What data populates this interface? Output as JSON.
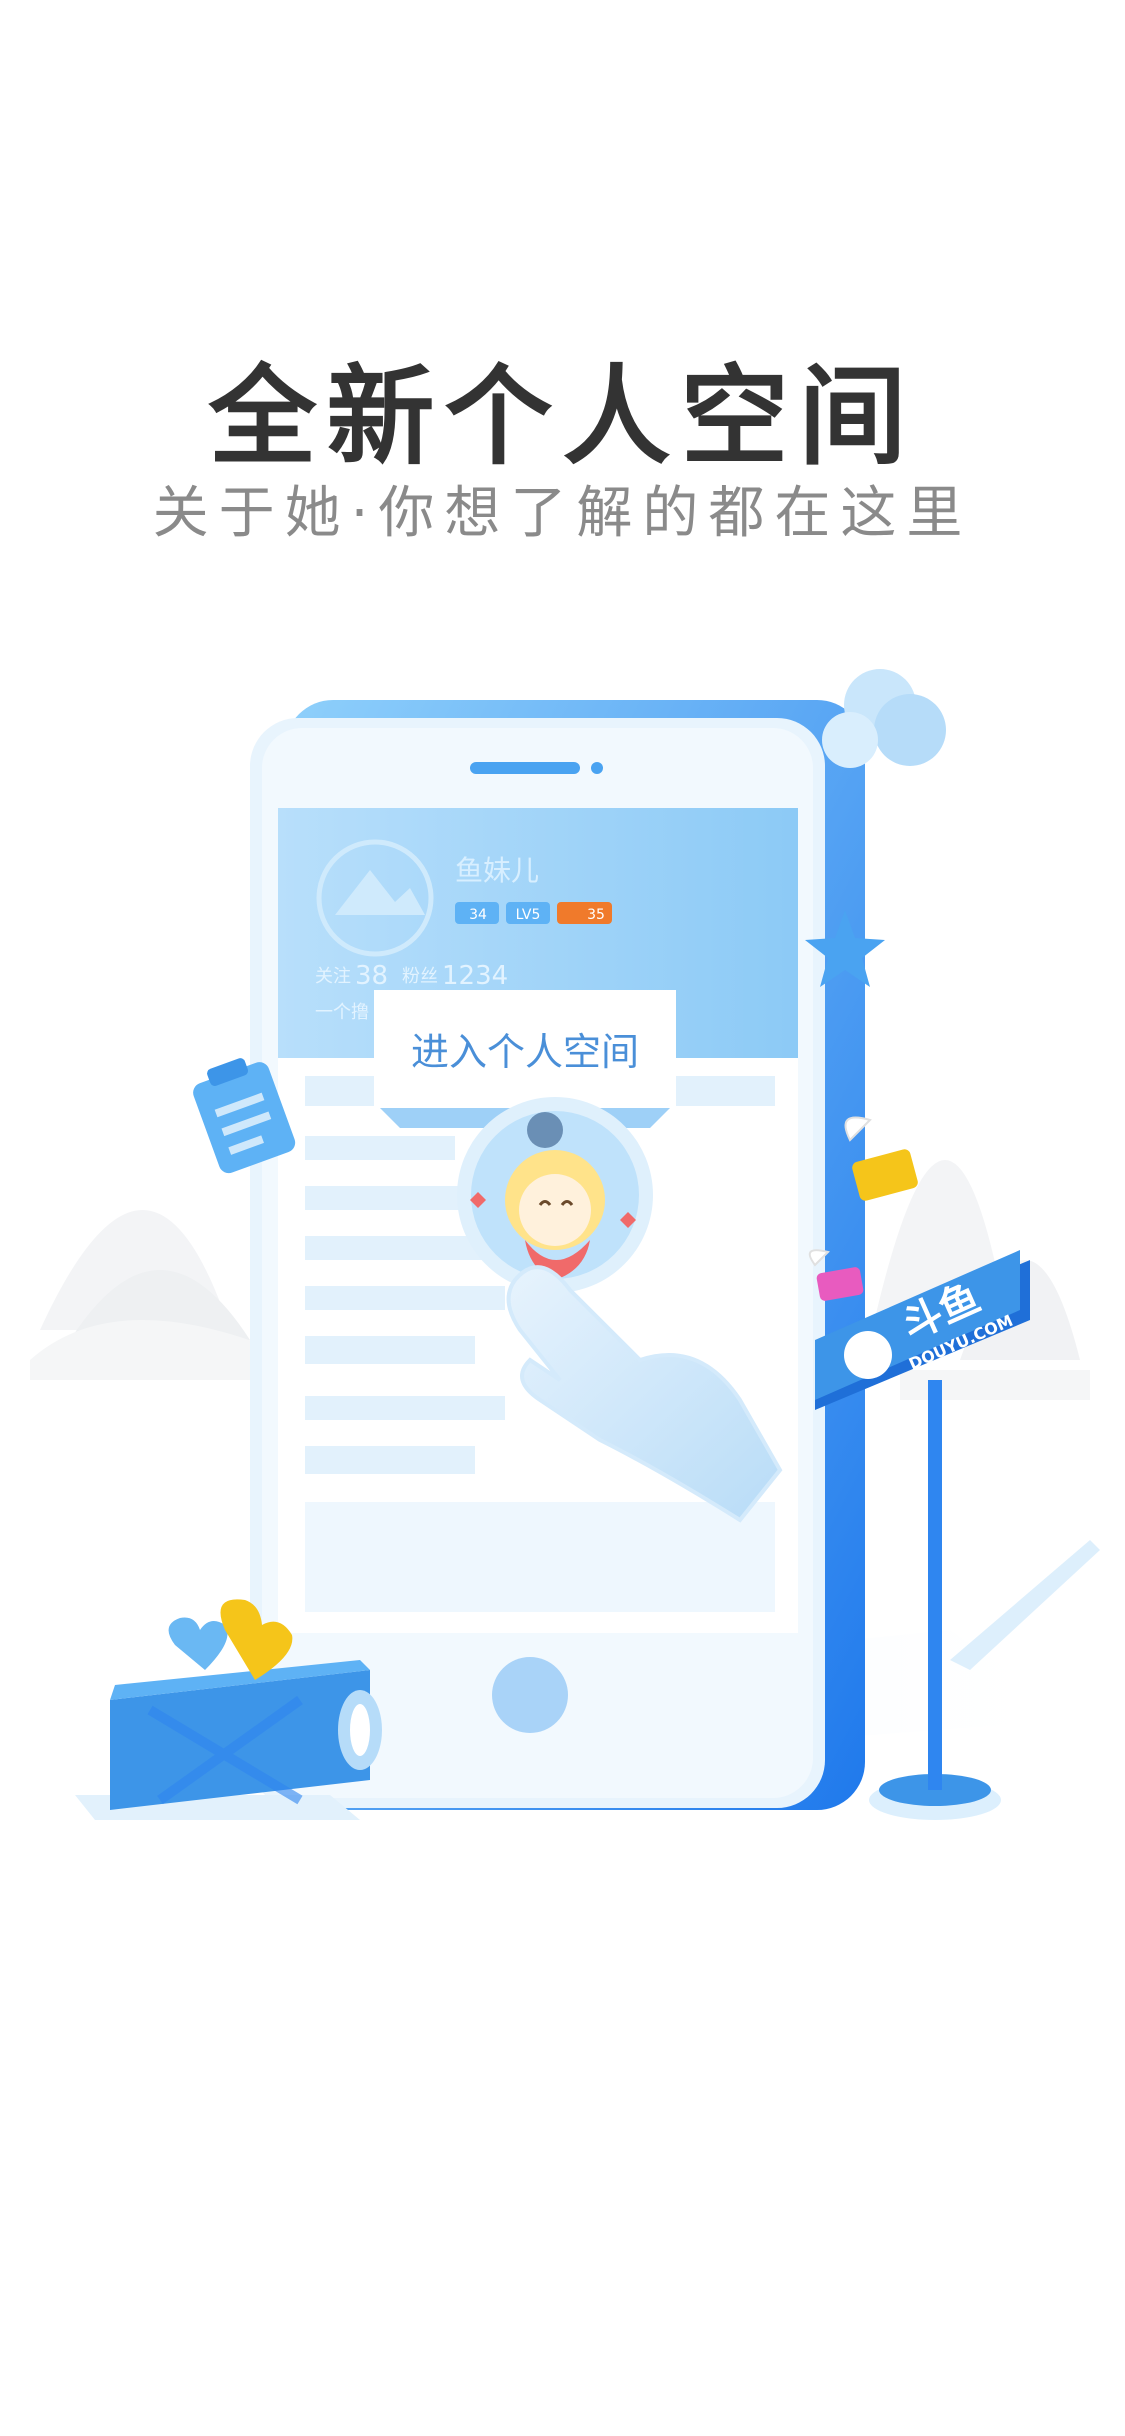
{
  "header": {
    "title": "全新个人空间",
    "subtitle": "关于她·你想了解的都在这里"
  },
  "profile_card": {
    "name": "鱼妹儿",
    "badge_fans": "34",
    "badge_level": "LV5",
    "badge_extra": "35",
    "follow_label": "关注",
    "follow_count": "38",
    "fans_label": "粉丝",
    "fans_count": "1234",
    "intro": "一个撸"
  },
  "enter_button_label": "进入个人空间",
  "sign": {
    "brand": "斗鱼",
    "domain": "DOUYU.COM"
  },
  "colors": {
    "title": "#333333",
    "subtitle": "#8a8a8a",
    "accent_blue": "#2f86f0",
    "light_blue": "#cde8fb",
    "button_text": "#4a8fd8"
  }
}
